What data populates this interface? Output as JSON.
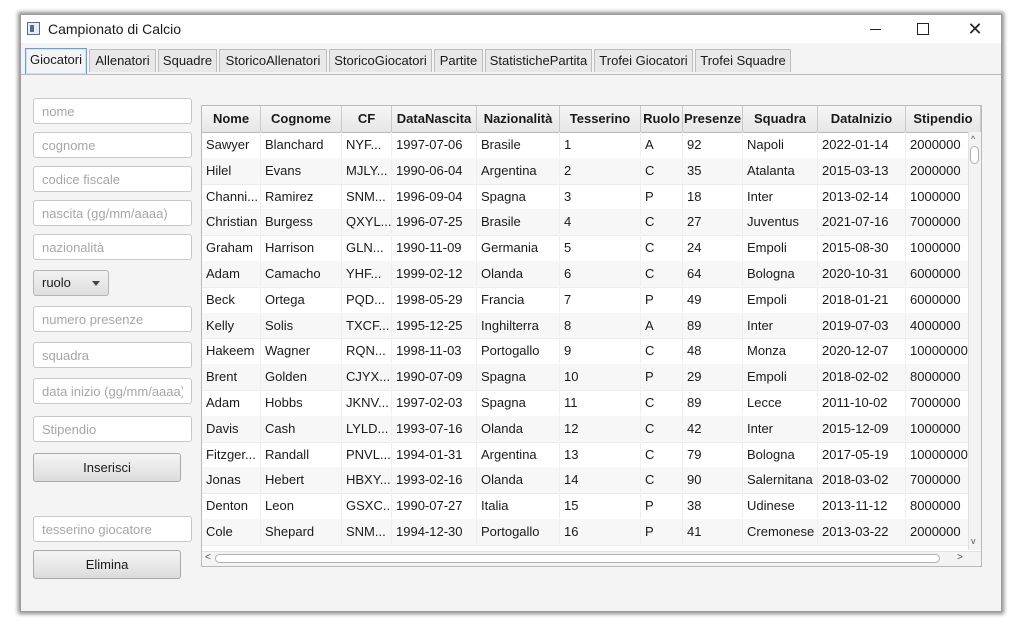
{
  "window": {
    "title": "Campionato di Calcio",
    "minimize": "—",
    "maximize": "☐",
    "close": "✕"
  },
  "tabs": [
    {
      "label": "Giocatori"
    },
    {
      "label": "Allenatori"
    },
    {
      "label": "Squadre"
    },
    {
      "label": "StoricoAllenatori"
    },
    {
      "label": "StoricoGiocatori"
    },
    {
      "label": "Partite"
    },
    {
      "label": "StatistichePartita"
    },
    {
      "label": "Trofei Giocatori"
    },
    {
      "label": "Trofei Squadre"
    }
  ],
  "active_tab": "Giocatori",
  "form": {
    "nome": "nome",
    "cognome": "cognome",
    "cf": "codice fiscale",
    "nascita": "nascita (gg/mm/aaaa)",
    "nazionalita": "nazionalità",
    "ruolo": "ruolo",
    "presenze": "numero presenze",
    "squadra": "squadra",
    "data_inizio": "data inizio (gg/mm/aaaa)",
    "stipendio": "Stipendio",
    "inserisci": "Inserisci",
    "tesserino": "tesserino giocatore",
    "elimina": "Elimina"
  },
  "table": {
    "columns": [
      "Nome",
      "Cognome",
      "CF",
      "DataNascita",
      "Nazionalità",
      "Tesserino",
      "Ruolo",
      "Presenze",
      "Squadra",
      "DataInizio",
      "Stipendio"
    ],
    "rows": [
      [
        "Sawyer",
        "Blanchard",
        "NYF...",
        "1997-07-06",
        "Brasile",
        "1",
        "A",
        "92",
        "Napoli",
        "2022-01-14",
        "2000000"
      ],
      [
        "Hilel",
        "Evans",
        "MJLY...",
        "1990-06-04",
        "Argentina",
        "2",
        "C",
        "35",
        "Atalanta",
        "2015-03-13",
        "2000000"
      ],
      [
        "Channi...",
        "Ramirez",
        "SNM...",
        "1996-09-04",
        "Spagna",
        "3",
        "P",
        "18",
        "Inter",
        "2013-02-14",
        "1000000"
      ],
      [
        "Christian",
        "Burgess",
        "QXYL...",
        "1996-07-25",
        "Brasile",
        "4",
        "C",
        "27",
        "Juventus",
        "2021-07-16",
        "7000000"
      ],
      [
        "Graham",
        "Harrison",
        "GLN...",
        "1990-11-09",
        "Germania",
        "5",
        "C",
        "24",
        "Empoli",
        "2015-08-30",
        "1000000"
      ],
      [
        "Adam",
        "Camacho",
        "YHF...",
        "1999-02-12",
        "Olanda",
        "6",
        "C",
        "64",
        "Bologna",
        "2020-10-31",
        "6000000"
      ],
      [
        "Beck",
        "Ortega",
        "PQD...",
        "1998-05-29",
        "Francia",
        "7",
        "P",
        "49",
        "Empoli",
        "2018-01-21",
        "6000000"
      ],
      [
        "Kelly",
        "Solis",
        "TXCF...",
        "1995-12-25",
        "Inghilterra",
        "8",
        "A",
        "89",
        "Inter",
        "2019-07-03",
        "4000000"
      ],
      [
        "Hakeem",
        "Wagner",
        "RQN...",
        "1998-11-03",
        "Portogallo",
        "9",
        "C",
        "48",
        "Monza",
        "2020-12-07",
        "10000000"
      ],
      [
        "Brent",
        "Golden",
        "CJYX...",
        "1990-07-09",
        "Spagna",
        "10",
        "P",
        "29",
        "Empoli",
        "2018-02-02",
        "8000000"
      ],
      [
        "Adam",
        "Hobbs",
        "JKNV...",
        "1997-02-03",
        "Spagna",
        "11",
        "C",
        "89",
        "Lecce",
        "2011-10-02",
        "7000000"
      ],
      [
        "Davis",
        "Cash",
        "LYLD...",
        "1993-07-16",
        "Olanda",
        "12",
        "C",
        "42",
        "Inter",
        "2015-12-09",
        "1000000"
      ],
      [
        "Fitzger...",
        "Randall",
        "PNVL...",
        "1994-01-31",
        "Argentina",
        "13",
        "C",
        "79",
        "Bologna",
        "2017-05-19",
        "10000000"
      ],
      [
        "Jonas",
        "Hebert",
        "HBXY...",
        "1993-02-16",
        "Olanda",
        "14",
        "C",
        "90",
        "Salernitana",
        "2018-03-02",
        "7000000"
      ],
      [
        "Denton",
        "Leon",
        "GSXC...",
        "1990-07-27",
        "Italia",
        "15",
        "P",
        "38",
        "Udinese",
        "2013-11-12",
        "8000000"
      ],
      [
        "Cole",
        "Shepard",
        "SNM...",
        "1994-12-30",
        "Portogallo",
        "16",
        "P",
        "41",
        "Cremonese",
        "2013-03-22",
        "2000000"
      ]
    ]
  }
}
